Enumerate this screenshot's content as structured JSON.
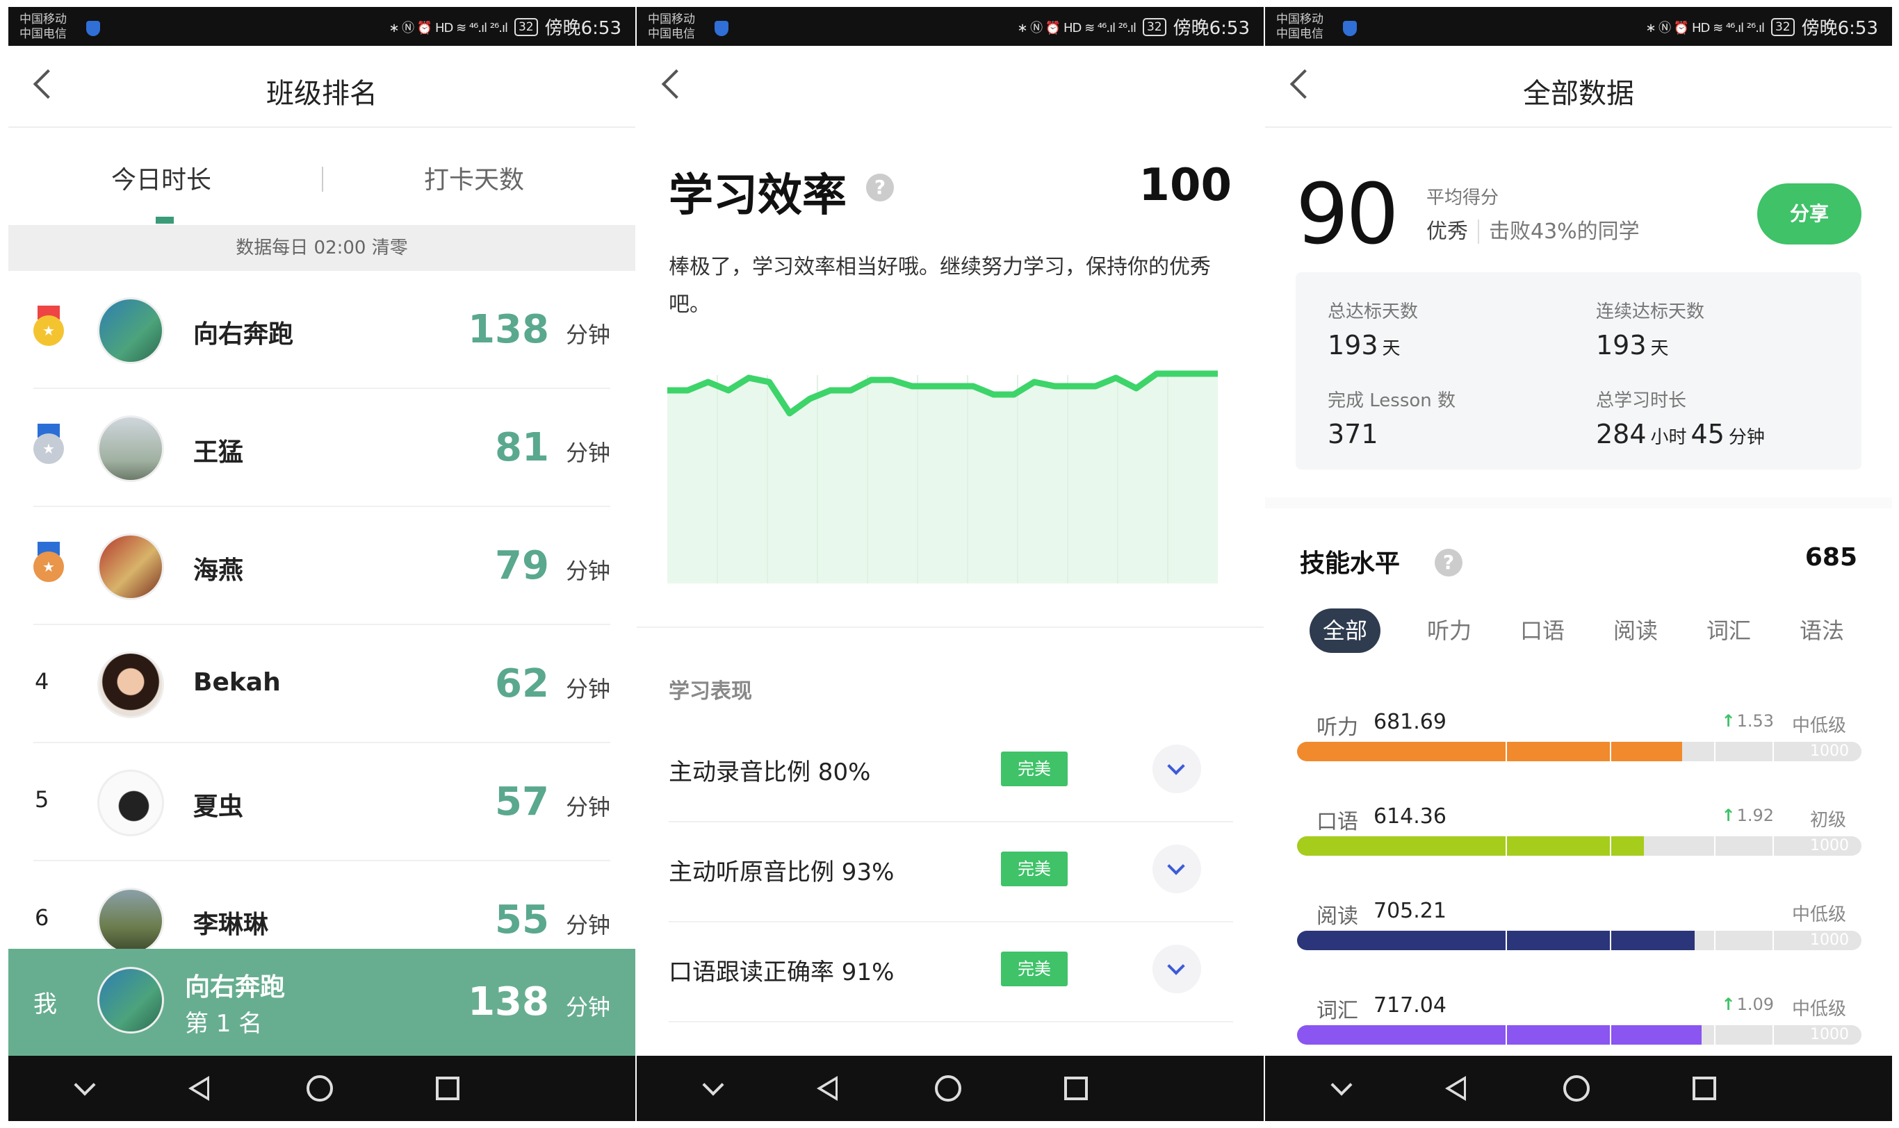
{
  "status": {
    "carrier1": "中国移动",
    "carrier2": "中国电信",
    "battery": "32",
    "time": "傍晚6:53",
    "icons": "∗ Ⓝ ⏰ HD ≋ ⁴⁶.ıl ²⁶.ıl"
  },
  "screen1": {
    "title": "班级排名",
    "tabs": [
      "今日时长",
      "打卡天数"
    ],
    "notice": "数据每日 02:00 清零",
    "unit": "分钟",
    "rows": [
      {
        "rank": "1",
        "medal": "gold",
        "name": "向右奔跑",
        "score": "138"
      },
      {
        "rank": "2",
        "medal": "silver",
        "name": "王猛",
        "score": "81"
      },
      {
        "rank": "3",
        "medal": "bronze",
        "name": "海燕",
        "score": "79"
      },
      {
        "rank": "4",
        "name": "Bekah",
        "score": "62"
      },
      {
        "rank": "5",
        "name": "夏虫",
        "score": "57"
      },
      {
        "rank": "6",
        "name": "李琳琳",
        "score": "55"
      }
    ],
    "me": {
      "label": "我",
      "name": "向右奔跑",
      "rank_text": "第 1 名",
      "score": "138"
    }
  },
  "screen2": {
    "title": "学习效率",
    "score": "100",
    "desc": "棒极了，学习效率相当好哦。继续努力学习，保持你的优秀吧。",
    "perf_title": "学习表现",
    "items": [
      {
        "label": "主动录音比例 80%",
        "badge": "完美"
      },
      {
        "label": "主动听原音比例 93%",
        "badge": "完美"
      },
      {
        "label": "口语跟读正确率 91%",
        "badge": "完美"
      }
    ]
  },
  "chart_data": {
    "type": "area",
    "color": "#3dd46a",
    "values": [
      86,
      86,
      90,
      86,
      92,
      90,
      75,
      82,
      86,
      86,
      91,
      91,
      88,
      88,
      88,
      88,
      84,
      84,
      90,
      88,
      88,
      88,
      92,
      87,
      94,
      94,
      94,
      94
    ]
  },
  "screen3": {
    "title": "全部数据",
    "avg_score": "90",
    "avg_label": "平均得分",
    "grade": "优秀",
    "beat": "击败43%的同学",
    "share": "分享",
    "stats": [
      {
        "label": "总达标天数",
        "value": "193",
        "unit": "天"
      },
      {
        "label": "连续达标天数",
        "value": "193",
        "unit": "天"
      },
      {
        "label": "完成 Lesson 数",
        "value": "371",
        "unit": ""
      },
      {
        "label": "总学习时长",
        "value": "284",
        "unit": "小时",
        "value2": "45",
        "unit2": "分钟"
      }
    ],
    "skill_title": "技能水平",
    "skill_total": "685",
    "skill_tabs": [
      "全部",
      "听力",
      "口语",
      "阅读",
      "词汇",
      "语法"
    ],
    "max_label": "1000",
    "skills": [
      {
        "name": "听力",
        "value": "681.69",
        "delta": "1.53",
        "level": "中低级",
        "fraction": 0.682,
        "color": "#f08a2c"
      },
      {
        "name": "口语",
        "value": "614.36",
        "delta": "1.92",
        "level": "初级",
        "fraction": 0.614,
        "color": "#a6cc1c"
      },
      {
        "name": "阅读",
        "value": "705.21",
        "delta": "",
        "level": "中低级",
        "fraction": 0.705,
        "color": "#2b357a"
      },
      {
        "name": "词汇",
        "value": "717.04",
        "delta": "1.09",
        "level": "中低级",
        "fraction": 0.717,
        "color": "#8a55f0"
      }
    ]
  }
}
